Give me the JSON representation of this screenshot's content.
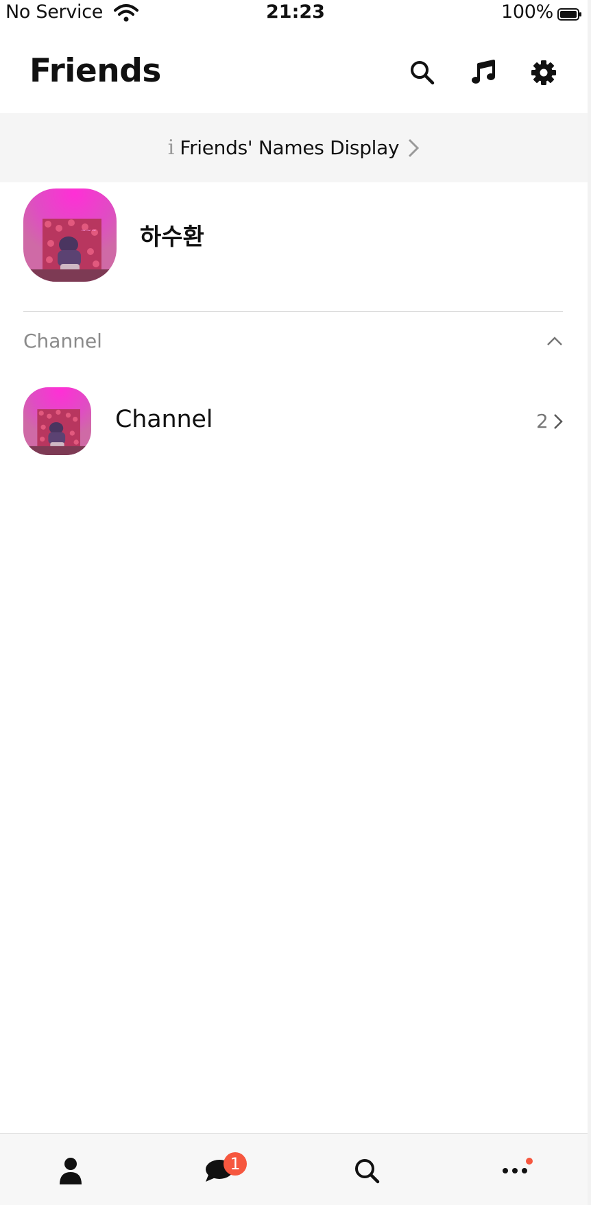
{
  "status_bar": {
    "carrier": "No Service",
    "time": "21:23",
    "battery": "100%"
  },
  "header": {
    "title": "Friends",
    "icons": [
      "search-icon",
      "music-icon",
      "gear-icon"
    ]
  },
  "banner": {
    "info_glyph": "i",
    "label": "Friends' Names Display"
  },
  "profile": {
    "name": "하수환",
    "avatar_icon": "profile-photo"
  },
  "section": {
    "title": "Channel",
    "expanded": true
  },
  "channel": {
    "name": "Channel",
    "count": "2"
  },
  "tabbar": {
    "chats_badge": "1",
    "tabs": [
      "person-icon",
      "chat-bubble-icon",
      "search-icon",
      "more-icon"
    ],
    "more_has_dot": true
  },
  "colors": {
    "badge": "#f6573f",
    "banner_bg": "#f5f5f5",
    "tabbar_bg": "#f7f7f7",
    "secondary_text": "#8a8a8a"
  }
}
